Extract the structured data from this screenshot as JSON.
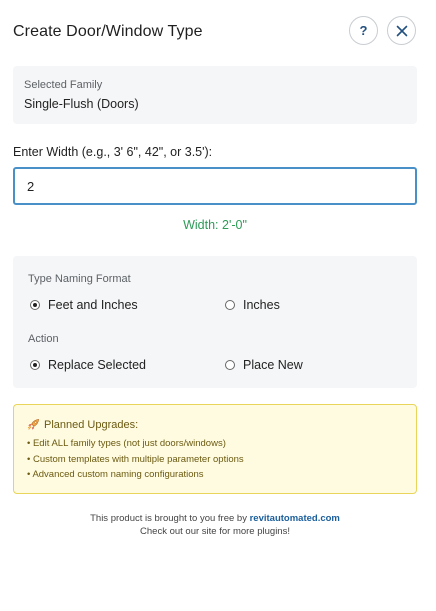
{
  "header": {
    "title": "Create Door/Window Type",
    "help_label": "?"
  },
  "family": {
    "label": "Selected Family",
    "value": "Single-Flush (Doors)"
  },
  "width": {
    "label": "Enter Width (e.g., 3' 6\", 42\", or 3.5'):",
    "value": "2",
    "preview": "Width: 2'-0\""
  },
  "naming": {
    "label": "Type Naming Format",
    "options": [
      "Feet and Inches",
      "Inches"
    ],
    "selected": "Feet and Inches"
  },
  "action": {
    "label": "Action",
    "options": [
      "Replace Selected",
      "Place New"
    ],
    "selected": "Replace Selected"
  },
  "upgrades": {
    "title": "Planned Upgrades:",
    "icon": "rocket-icon",
    "items": [
      "• Edit ALL family types (not just doors/windows)",
      "• Custom templates with multiple parameter options",
      "• Advanced custom naming configurations"
    ]
  },
  "footer": {
    "prefix": "This product is brought to you free by ",
    "link": "revitautomated.com",
    "line2": "Check out our site for more plugins!"
  },
  "colors": {
    "accent": "#4a90c8",
    "success": "#2e9b57",
    "notice_bg": "#fffbe0",
    "notice_border": "#e8d55a"
  }
}
